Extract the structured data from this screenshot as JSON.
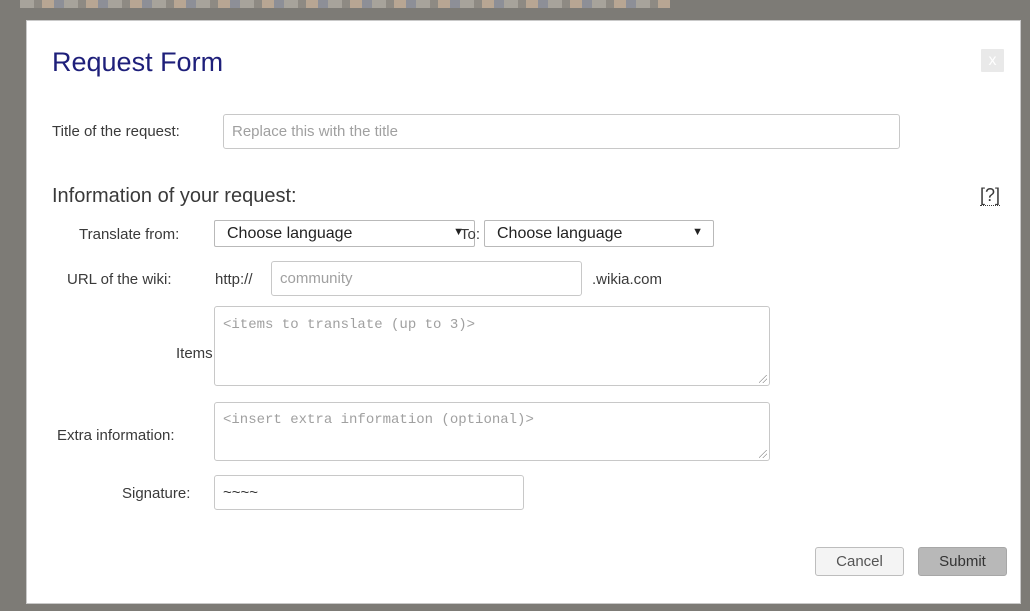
{
  "dialog": {
    "title": "Request Form",
    "close_label": "x"
  },
  "form": {
    "title_label": "Title of the request:",
    "title_placeholder": "Replace this with the title",
    "section_title": "Information of your request:",
    "help_label": "[?]",
    "translate_from_label": "Translate from:",
    "translate_from_value": "Choose language",
    "to_label": "To:",
    "to_value": "Choose language",
    "url_label": "URL of the wiki:",
    "url_prefix": "http://",
    "url_placeholder": "community",
    "url_suffix": ".wikia.com",
    "items_label": "Items:",
    "items_placeholder": "<items to translate (up to 3)>",
    "extra_label": "Extra information:",
    "extra_placeholder": "<insert extra information (optional)>",
    "signature_label": "Signature:",
    "signature_value": "~~~~"
  },
  "buttons": {
    "cancel": "Cancel",
    "submit": "Submit"
  }
}
